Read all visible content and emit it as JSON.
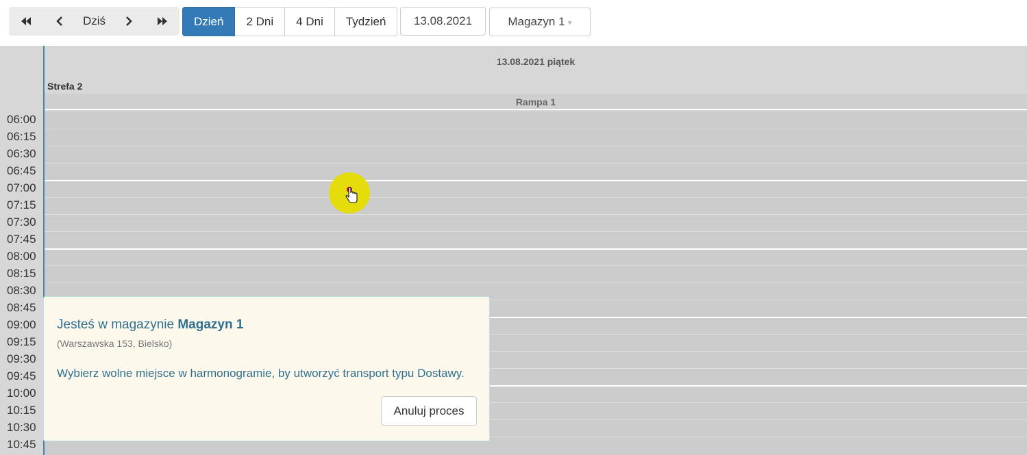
{
  "toolbar": {
    "nav": {
      "first_icon": "double-chevron-left-icon",
      "prev_icon": "chevron-left-icon",
      "today_label": "Dziś",
      "next_icon": "chevron-right-icon",
      "last_icon": "double-chevron-right-icon"
    },
    "views": [
      {
        "label": "Dzień",
        "active": true
      },
      {
        "label": "2 Dni",
        "active": false
      },
      {
        "label": "4 Dni",
        "active": false
      },
      {
        "label": "Tydzień",
        "active": false
      }
    ],
    "date_value": "13.08.2021",
    "warehouse_select": {
      "selected": "Magazyn 1",
      "caret": "▾"
    }
  },
  "calendar": {
    "day_title": "13.08.2021 piątek",
    "zone_label": "Strefa 2",
    "ramp_label": "Rampa 1",
    "times": [
      "06:00",
      "06:15",
      "06:30",
      "06:45",
      "07:00",
      "07:15",
      "07:30",
      "07:45",
      "08:00",
      "08:15",
      "08:30",
      "08:45",
      "09:00",
      "09:15",
      "09:30",
      "09:45",
      "10:00",
      "10:15",
      "10:30",
      "10:45"
    ]
  },
  "popover": {
    "title_prefix": "Jesteś w magazynie ",
    "title_warehouse": "Magazyn 1",
    "address": "(Warszawska 153, Bielsko)",
    "message": "Wybierz wolne miejsce w harmonogramie, by utworzyć transport typu Dostawy.",
    "cancel_label": "Anuluj proces"
  },
  "colors": {
    "accent": "#337ab7",
    "popover_text": "#31708f",
    "popover_bg": "#fcf8ec",
    "cursor_highlight": "#e6dc00"
  }
}
